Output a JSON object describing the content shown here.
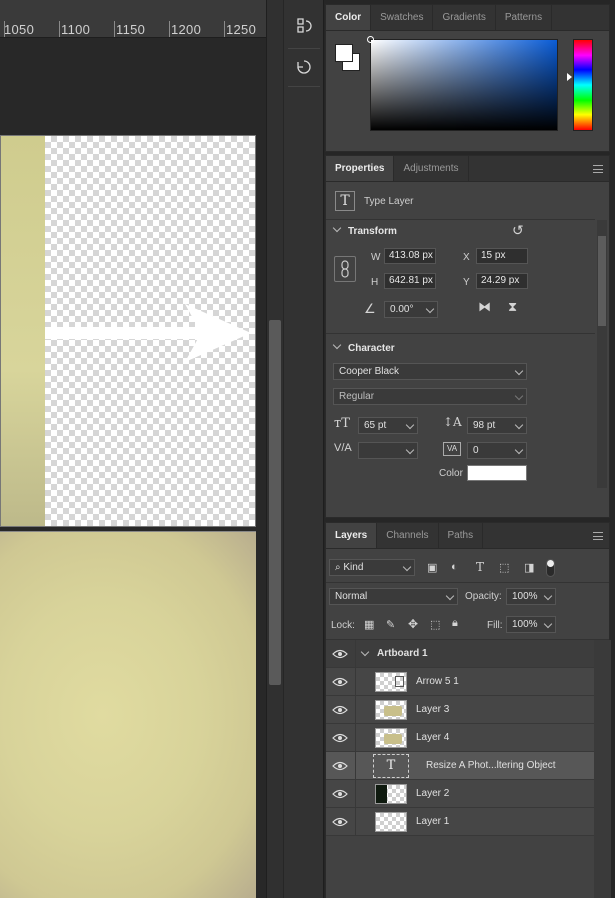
{
  "ruler": {
    "labels": [
      "1050",
      "1100",
      "1150",
      "1200",
      "1250"
    ]
  },
  "color_panel": {
    "tabs": [
      "Color",
      "Swatches",
      "Gradients",
      "Patterns"
    ],
    "active_tab": "Color",
    "foreground": "#ffffff",
    "background": "#ffffff",
    "hue_color": "#0a5cd6"
  },
  "properties_panel": {
    "tabs": [
      "Properties",
      "Adjustments"
    ],
    "layer_type": "Type Layer",
    "transform": {
      "title": "Transform",
      "w_label": "W",
      "w_value": "413.08 px",
      "h_label": "H",
      "h_value": "642.81 px",
      "x_label": "X",
      "x_value": "15 px",
      "y_label": "Y",
      "y_value": "24.29 px",
      "angle_value": "0.00°"
    },
    "character": {
      "title": "Character",
      "font_family": "Cooper Black",
      "font_style": "Regular",
      "font_size": "65 pt",
      "leading": "98 pt",
      "kerning": "",
      "tracking": "0",
      "color_label": "Color",
      "color_value": "#ffffff"
    }
  },
  "layers_panel": {
    "tabs": [
      "Layers",
      "Channels",
      "Paths"
    ],
    "filter_kind": "Kind",
    "blend_mode": "Normal",
    "opacity_label": "Opacity:",
    "opacity_value": "100%",
    "lock_label": "Lock:",
    "fill_label": "Fill:",
    "fill_value": "100%",
    "artboard_name": "Artboard 1",
    "layers": [
      {
        "name": "Arrow 5 1",
        "kind": "shape",
        "selected": false
      },
      {
        "name": "Layer 3",
        "kind": "image",
        "selected": false
      },
      {
        "name": "Layer 4",
        "kind": "image",
        "selected": false
      },
      {
        "name": "Resize  A Phot...ltering    Object",
        "kind": "text",
        "selected": true
      },
      {
        "name": "Layer 2",
        "kind": "dark",
        "selected": false
      },
      {
        "name": "Layer 1",
        "kind": "empty",
        "selected": false
      }
    ]
  }
}
